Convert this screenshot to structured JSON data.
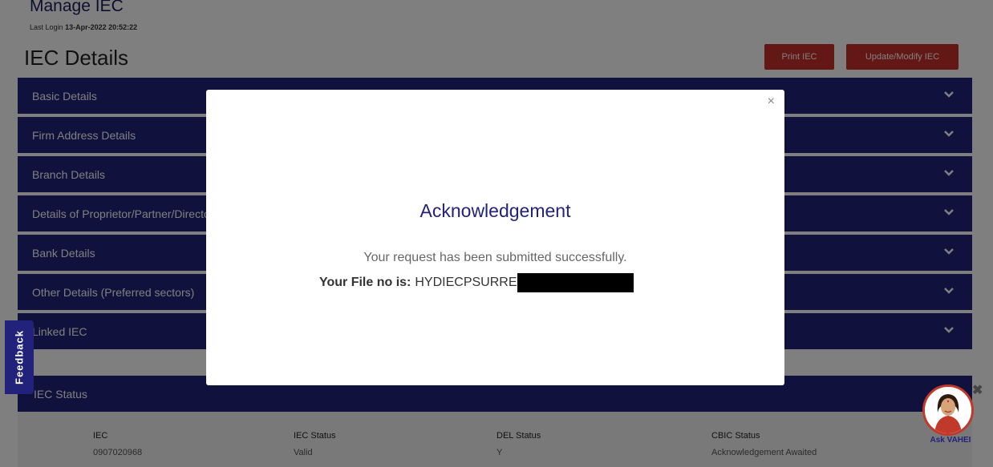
{
  "header": {
    "title": "Manage IEC",
    "last_login_label": "Last Login",
    "last_login_value": "13-Apr-2022 20:52:22"
  },
  "details": {
    "title": "IEC Details",
    "print_label": "Print IEC",
    "update_label": "Update/Modify IEC"
  },
  "accordions": [
    {
      "label": "Basic Details"
    },
    {
      "label": "Firm Address Details"
    },
    {
      "label": "Branch Details"
    },
    {
      "label": "Details of Proprietor/Partner/Director"
    },
    {
      "label": "Bank Details"
    },
    {
      "label": "Other Details (Preferred sectors)"
    },
    {
      "label": "Linked IEC"
    }
  ],
  "status": {
    "title": "IEC Status",
    "columns": [
      {
        "header": "IEC",
        "value": "0907020968"
      },
      {
        "header": "IEC Status",
        "value": "Valid"
      },
      {
        "header": "DEL Status",
        "value": "Y"
      },
      {
        "header": "CBIC Status",
        "value": "Acknowledgement Awaited"
      }
    ]
  },
  "feedback": {
    "label": "Feedback"
  },
  "assistant": {
    "label": "Ask VAHEI"
  },
  "modal": {
    "close": "×",
    "title": "Acknowledgement",
    "message": "Your request has been submitted successfully.",
    "file_label": "Your File no is:",
    "file_value": "HYDIECPSURRE"
  },
  "colors": {
    "navy": "#23227a",
    "red_button": "#c9302c"
  }
}
